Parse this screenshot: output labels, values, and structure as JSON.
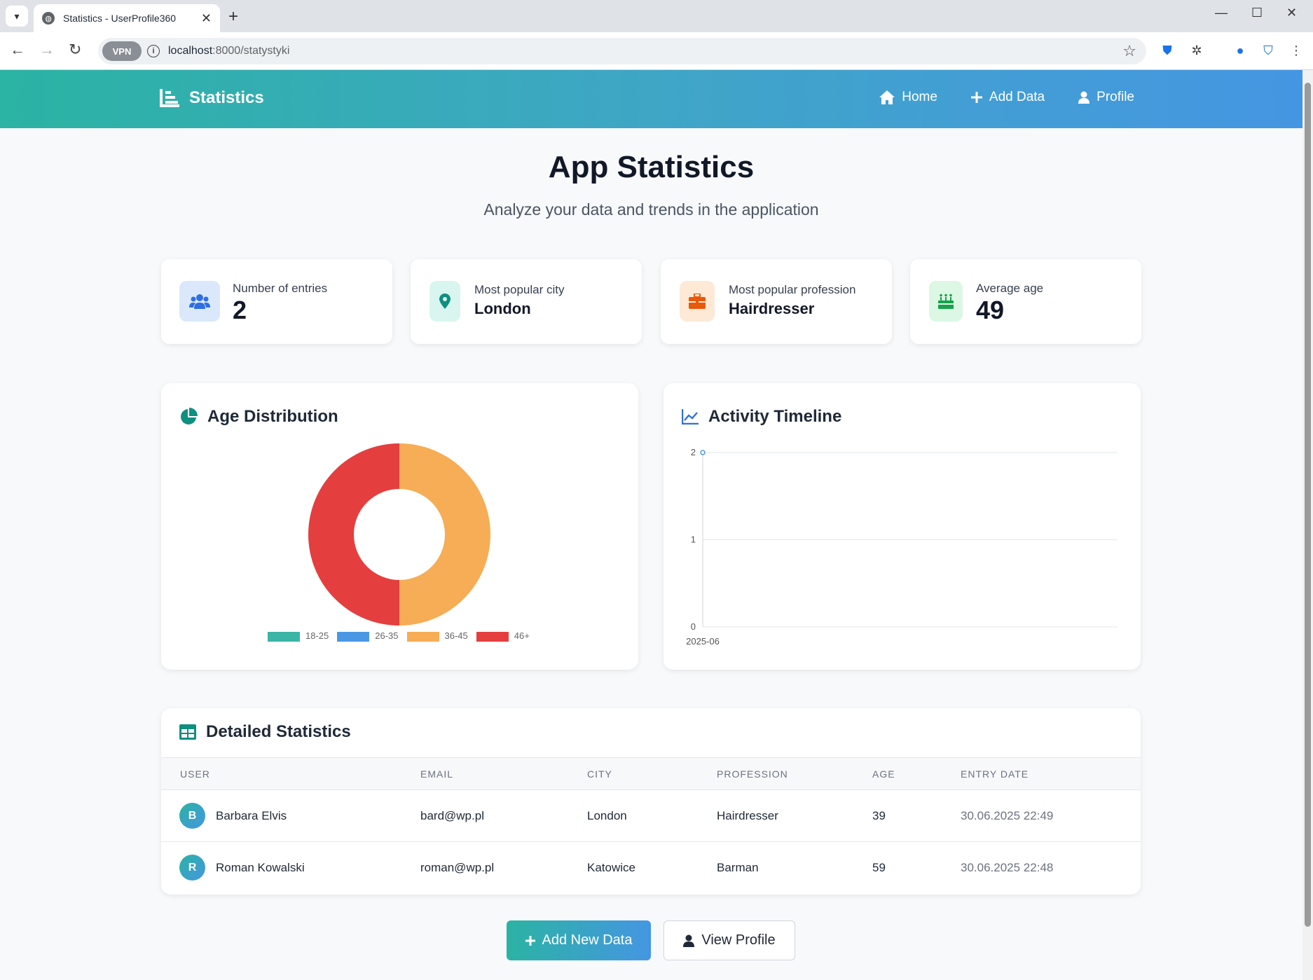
{
  "browser": {
    "tab_title": "Statistics - UserProfile360",
    "url_host": "localhost",
    "url_path": ":8000/statystyki",
    "vpn_label": "VPN"
  },
  "header": {
    "brand": "Statistics",
    "nav": {
      "home": "Home",
      "add_data": "Add Data",
      "profile": "Profile"
    }
  },
  "page": {
    "title": "App Statistics",
    "subtitle": "Analyze your data and trends in the application"
  },
  "stats": [
    {
      "label": "Number of entries",
      "value": "2",
      "icon": "users-icon",
      "color": "#dbe8fb"
    },
    {
      "label": "Most popular city",
      "value": "London",
      "icon": "map-pin-icon",
      "color": "#d8f6ef"
    },
    {
      "label": "Most popular profession",
      "value": "Hairdresser",
      "icon": "briefcase-icon",
      "color": "#fde9d6"
    },
    {
      "label": "Average age",
      "value": "49",
      "icon": "birthday-cake-icon",
      "color": "#dcf7e4"
    }
  ],
  "age_chart": {
    "title": "Age Distribution",
    "chart_data": {
      "type": "pie",
      "categories": [
        "18-25",
        "26-35",
        "36-45",
        "46+"
      ],
      "values": [
        0,
        0,
        1,
        1
      ],
      "colors": [
        "#3bb5a6",
        "#4a98e4",
        "#f6ad55",
        "#e53e3e"
      ],
      "legend": "bottom"
    }
  },
  "timeline_chart": {
    "title": "Activity Timeline",
    "chart_data": {
      "type": "line",
      "x": [
        "2025-06"
      ],
      "values": [
        2
      ],
      "ylim": [
        0,
        2
      ],
      "yticks": [
        "0",
        "1",
        "2"
      ],
      "grid": true,
      "color": "#4a98e4"
    }
  },
  "table": {
    "title": "Detailed Statistics",
    "columns": [
      "User",
      "Email",
      "City",
      "Profession",
      "Age",
      "Entry Date"
    ],
    "rows": [
      {
        "initial": "B",
        "user": "Barbara Elvis",
        "email": "bard@wp.pl",
        "city": "London",
        "profession": "Hairdresser",
        "age": "39",
        "date": "30.06.2025 22:49"
      },
      {
        "initial": "R",
        "user": "Roman Kowalski",
        "email": "roman@wp.pl",
        "city": "Katowice",
        "profession": "Barman",
        "age": "59",
        "date": "30.06.2025 22:48"
      }
    ]
  },
  "actions": {
    "add_new": "Add New Data",
    "view_profile": "View Profile"
  }
}
